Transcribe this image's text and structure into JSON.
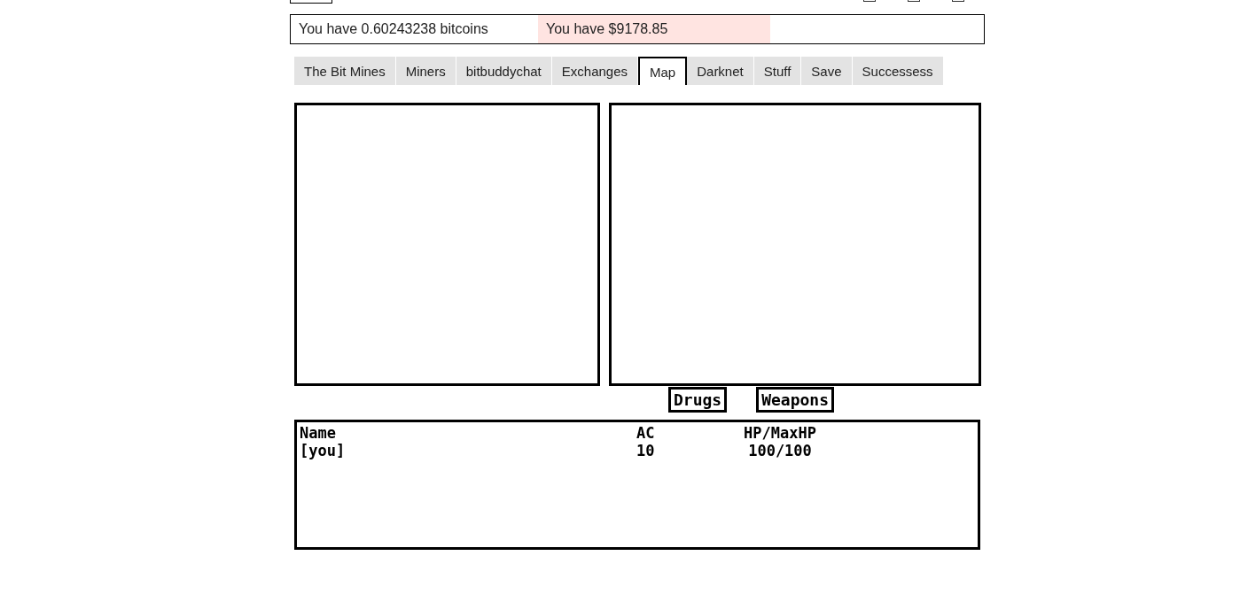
{
  "top_checkboxes": [
    {
      "checked": false
    },
    {
      "checked": false
    },
    {
      "checked": false
    }
  ],
  "stats": [
    {
      "text": "You have 0.60243238 bitcoins",
      "highlight": false
    },
    {
      "text": "You have $9178.85",
      "highlight": true
    }
  ],
  "tabs": [
    {
      "label": "The Bit Mines",
      "selected": false
    },
    {
      "label": "Miners",
      "selected": false
    },
    {
      "label": "bitbuddychat",
      "selected": false
    },
    {
      "label": "Exchanges",
      "selected": false
    },
    {
      "label": "Map",
      "selected": true
    },
    {
      "label": "Darknet",
      "selected": false
    },
    {
      "label": "Stuff",
      "selected": false
    },
    {
      "label": "Save",
      "selected": false
    },
    {
      "label": "Successess",
      "selected": false
    }
  ],
  "inventory_buttons": [
    "Drugs",
    "Weapons"
  ],
  "party_table": {
    "columns": [
      "Name",
      "AC",
      "HP/MaxHP"
    ],
    "rows": [
      [
        "[you]",
        "10",
        "100/100"
      ]
    ]
  }
}
